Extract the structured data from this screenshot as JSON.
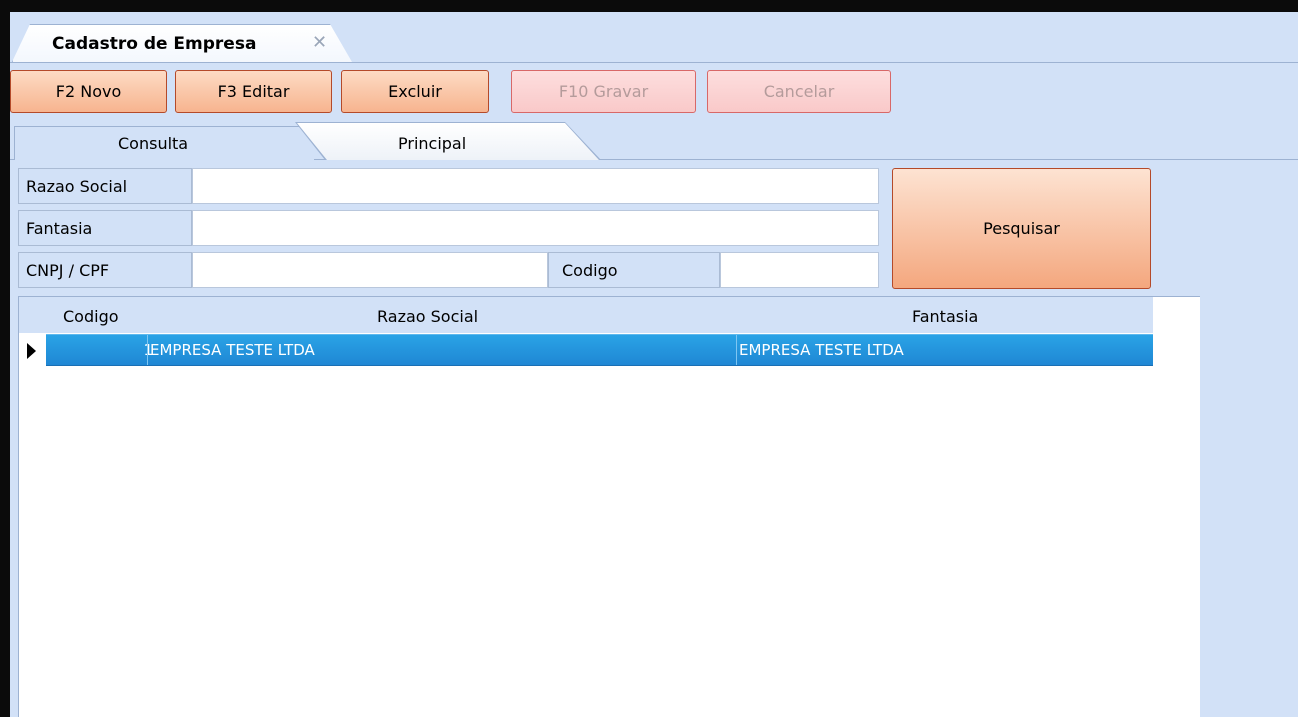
{
  "document_tab": {
    "title": "Cadastro de Empresa",
    "close_icon": "close-icon"
  },
  "toolbar": {
    "novo": "F2 Novo",
    "editar": "F3 Editar",
    "excluir": "Excluir",
    "gravar": "F10 Gravar",
    "cancelar": "Cancelar"
  },
  "tabs": {
    "consulta": "Consulta",
    "principal": "Principal"
  },
  "search": {
    "razao_social_label": "Razao Social",
    "razao_social_value": "",
    "fantasia_label": "Fantasia",
    "fantasia_value": "",
    "cnpj_label": "CNPJ / CPF",
    "cnpj_value": "",
    "codigo_label": "Codigo",
    "codigo_value": "",
    "button": "Pesquisar"
  },
  "grid": {
    "columns": [
      "Codigo",
      "Razao Social",
      "Fantasia"
    ],
    "rows": [
      {
        "codigo": "1",
        "razao_social": "EMPRESA TESTE LTDA",
        "fantasia": "EMPRESA TESTE LTDA"
      }
    ],
    "selected_row_color": "#1f87d4"
  },
  "colors": {
    "background": "#d2e1f7",
    "button_orange": "#f7b48f",
    "disabled_red": "#f9c9c9"
  }
}
